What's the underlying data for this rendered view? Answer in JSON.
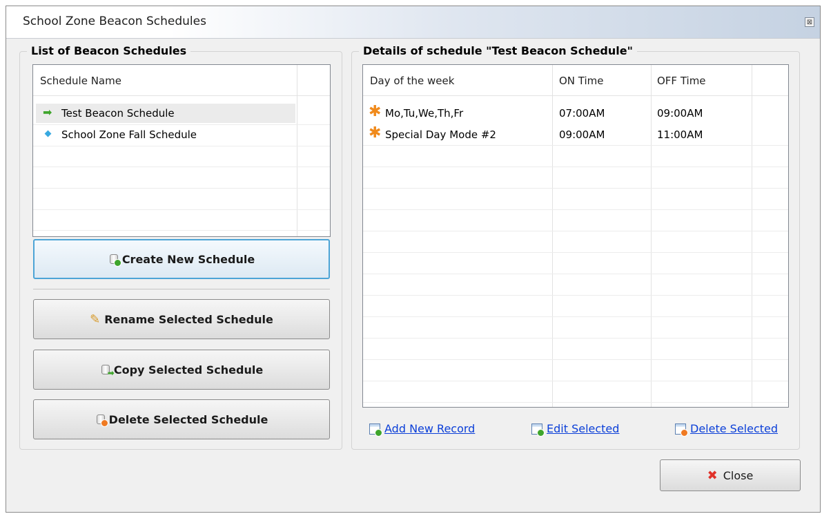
{
  "window": {
    "title": "School Zone Beacon Schedules",
    "close_glyph": "⊠"
  },
  "list_panel": {
    "title": "List of Beacon Schedules",
    "column_header": "Schedule Name",
    "items": [
      {
        "label": "Test Beacon Schedule",
        "icon": "green-arrow-icon",
        "selected": true
      },
      {
        "label": "School Zone Fall Schedule",
        "icon": "blue-diamond-icon",
        "selected": false
      }
    ],
    "buttons": {
      "create": "Create New Schedule",
      "rename": "Rename Selected Schedule",
      "copy": "Copy Selected Schedule",
      "delete": "Delete Selected Schedule"
    }
  },
  "details_panel": {
    "title": "Details of schedule \"Test Beacon Schedule\"",
    "columns": [
      "Day of the week",
      "ON Time",
      "OFF Time"
    ],
    "rows": [
      {
        "day": "Mo,Tu,We,Th,Fr",
        "on": "07:00AM",
        "off": "09:00AM",
        "icon": "orange-star-icon"
      },
      {
        "day": "Special Day Mode #2",
        "on": "09:00AM",
        "off": "11:00AM",
        "icon": "orange-star-icon"
      }
    ],
    "links": {
      "add": "Add New Record",
      "edit": "Edit Selected",
      "delete": "Delete Selected"
    }
  },
  "footer": {
    "close_label": "Close",
    "close_glyph": "✖"
  },
  "colors": {
    "accent_border": "#4ca4d6",
    "link": "#0b3fd8",
    "close_x": "#e0322a",
    "star": "#f08a1c"
  }
}
